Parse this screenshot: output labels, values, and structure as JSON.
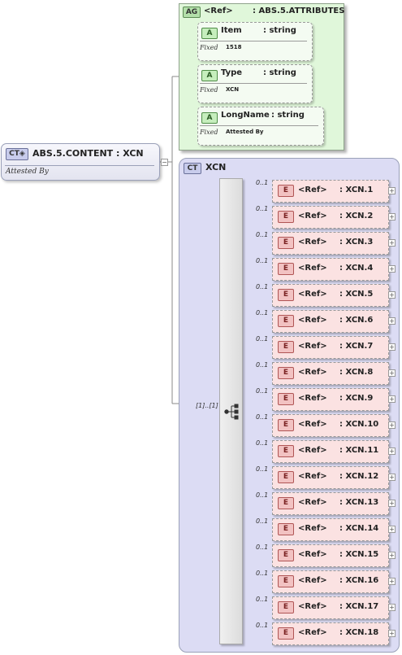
{
  "root": {
    "badge": "CT",
    "title": "ABS.5.CONTENT : XCN",
    "documentation": "Attested By"
  },
  "attribute_group": {
    "badge": "AG",
    "ref": "<Ref>",
    "type": ": ABS.5.ATTRIBUTES"
  },
  "attributes": [
    {
      "badge": "A",
      "name": "Item",
      "type": ": string",
      "fixed_label": "Fixed",
      "fixed_value": "1518"
    },
    {
      "badge": "A",
      "name": "Type",
      "type": ": string",
      "fixed_label": "Fixed",
      "fixed_value": "XCN"
    },
    {
      "badge": "A",
      "name": "LongName",
      "type": ": string",
      "fixed_label": "Fixed",
      "fixed_value": "Attested By"
    }
  ],
  "complex_type": {
    "badge": "CT",
    "name": "XCN"
  },
  "sequence": {
    "multiplicity": "[1]..[1]"
  },
  "elements": [
    {
      "badge": "E",
      "ref": "<Ref>",
      "type": ": XCN.1",
      "occurs": "0..1",
      "expand": "+"
    },
    {
      "badge": "E",
      "ref": "<Ref>",
      "type": ": XCN.2",
      "occurs": "0..1",
      "expand": "+"
    },
    {
      "badge": "E",
      "ref": "<Ref>",
      "type": ": XCN.3",
      "occurs": "0..1",
      "expand": "+"
    },
    {
      "badge": "E",
      "ref": "<Ref>",
      "type": ": XCN.4",
      "occurs": "0..1",
      "expand": "+"
    },
    {
      "badge": "E",
      "ref": "<Ref>",
      "type": ": XCN.5",
      "occurs": "0..1",
      "expand": "+"
    },
    {
      "badge": "E",
      "ref": "<Ref>",
      "type": ": XCN.6",
      "occurs": "0..1",
      "expand": "+"
    },
    {
      "badge": "E",
      "ref": "<Ref>",
      "type": ": XCN.7",
      "occurs": "0..1",
      "expand": "+"
    },
    {
      "badge": "E",
      "ref": "<Ref>",
      "type": ": XCN.8",
      "occurs": "0..1",
      "expand": "+"
    },
    {
      "badge": "E",
      "ref": "<Ref>",
      "type": ": XCN.9",
      "occurs": "0..1",
      "expand": "+"
    },
    {
      "badge": "E",
      "ref": "<Ref>",
      "type": ": XCN.10",
      "occurs": "0..1",
      "expand": "+"
    },
    {
      "badge": "E",
      "ref": "<Ref>",
      "type": ": XCN.11",
      "occurs": "0..1",
      "expand": "+"
    },
    {
      "badge": "E",
      "ref": "<Ref>",
      "type": ": XCN.12",
      "occurs": "0..1",
      "expand": "+"
    },
    {
      "badge": "E",
      "ref": "<Ref>",
      "type": ": XCN.13",
      "occurs": "0..1",
      "expand": "+"
    },
    {
      "badge": "E",
      "ref": "<Ref>",
      "type": ": XCN.14",
      "occurs": "0..1",
      "expand": "+"
    },
    {
      "badge": "E",
      "ref": "<Ref>",
      "type": ": XCN.15",
      "occurs": "0..1",
      "expand": "+"
    },
    {
      "badge": "E",
      "ref": "<Ref>",
      "type": ": XCN.16",
      "occurs": "0..1",
      "expand": "+"
    },
    {
      "badge": "E",
      "ref": "<Ref>",
      "type": ": XCN.17",
      "occurs": "0..1",
      "expand": "+"
    },
    {
      "badge": "E",
      "ref": "<Ref>",
      "type": ": XCN.18",
      "occurs": "0..1",
      "expand": "+"
    }
  ],
  "collapse_symbol": "−"
}
